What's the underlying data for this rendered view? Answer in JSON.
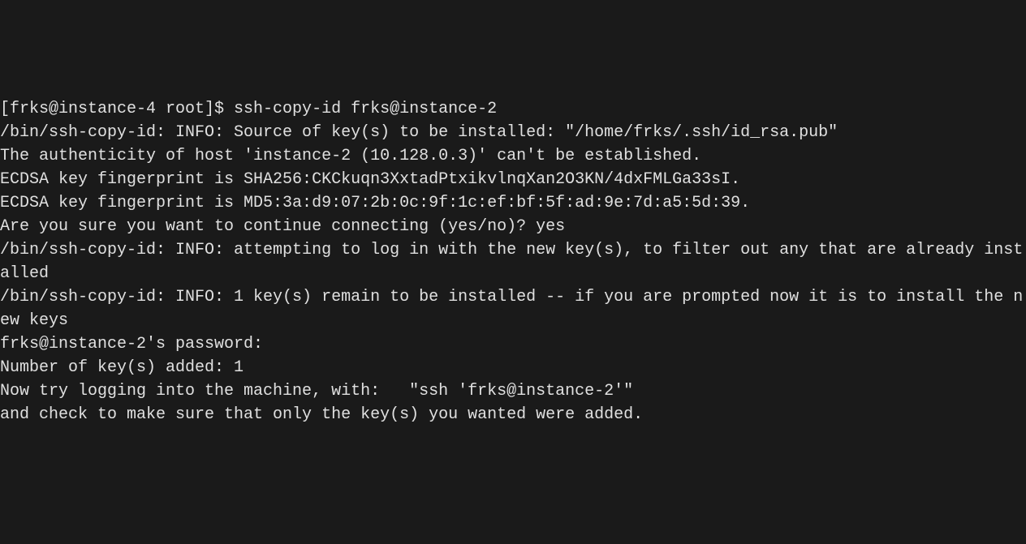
{
  "terminal": {
    "prompt": "[frks@instance-4 root]$ ",
    "command": "ssh-copy-id frks@instance-2",
    "lines": [
      "/bin/ssh-copy-id: INFO: Source of key(s) to be installed: \"/home/frks/.ssh/id_rsa.pub\"",
      "The authenticity of host 'instance-2 (10.128.0.3)' can't be established.",
      "ECDSA key fingerprint is SHA256:CKCkuqn3XxtadPtxikvlnqXan2O3KN/4dxFMLGa33sI.",
      "ECDSA key fingerprint is MD5:3a:d9:07:2b:0c:9f:1c:ef:bf:5f:ad:9e:7d:a5:5d:39.",
      "Are you sure you want to continue connecting (yes/no)? yes",
      "/bin/ssh-copy-id: INFO: attempting to log in with the new key(s), to filter out any that are already installed",
      "/bin/ssh-copy-id: INFO: 1 key(s) remain to be installed -- if you are prompted now it is to install the new keys",
      "frks@instance-2's password:",
      "",
      "Number of key(s) added: 1",
      "",
      "Now try logging into the machine, with:   \"ssh 'frks@instance-2'\"",
      "and check to make sure that only the key(s) you wanted were added."
    ]
  }
}
